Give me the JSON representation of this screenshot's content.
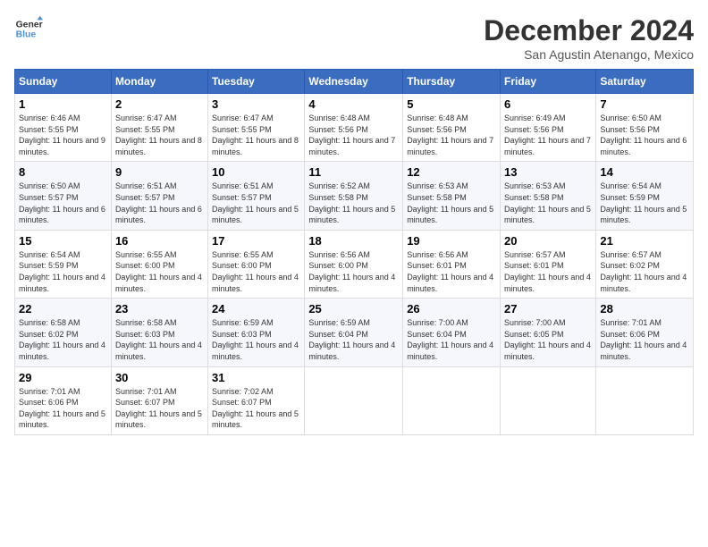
{
  "logo": {
    "line1": "General",
    "line2": "Blue"
  },
  "title": "December 2024",
  "location": "San Agustin Atenango, Mexico",
  "days_of_week": [
    "Sunday",
    "Monday",
    "Tuesday",
    "Wednesday",
    "Thursday",
    "Friday",
    "Saturday"
  ],
  "weeks": [
    [
      {
        "day": "1",
        "sunrise": "6:46 AM",
        "sunset": "5:55 PM",
        "daylight": "11 hours and 9 minutes."
      },
      {
        "day": "2",
        "sunrise": "6:47 AM",
        "sunset": "5:55 PM",
        "daylight": "11 hours and 8 minutes."
      },
      {
        "day": "3",
        "sunrise": "6:47 AM",
        "sunset": "5:55 PM",
        "daylight": "11 hours and 8 minutes."
      },
      {
        "day": "4",
        "sunrise": "6:48 AM",
        "sunset": "5:56 PM",
        "daylight": "11 hours and 7 minutes."
      },
      {
        "day": "5",
        "sunrise": "6:48 AM",
        "sunset": "5:56 PM",
        "daylight": "11 hours and 7 minutes."
      },
      {
        "day": "6",
        "sunrise": "6:49 AM",
        "sunset": "5:56 PM",
        "daylight": "11 hours and 7 minutes."
      },
      {
        "day": "7",
        "sunrise": "6:50 AM",
        "sunset": "5:56 PM",
        "daylight": "11 hours and 6 minutes."
      }
    ],
    [
      {
        "day": "8",
        "sunrise": "6:50 AM",
        "sunset": "5:57 PM",
        "daylight": "11 hours and 6 minutes."
      },
      {
        "day": "9",
        "sunrise": "6:51 AM",
        "sunset": "5:57 PM",
        "daylight": "11 hours and 6 minutes."
      },
      {
        "day": "10",
        "sunrise": "6:51 AM",
        "sunset": "5:57 PM",
        "daylight": "11 hours and 5 minutes."
      },
      {
        "day": "11",
        "sunrise": "6:52 AM",
        "sunset": "5:58 PM",
        "daylight": "11 hours and 5 minutes."
      },
      {
        "day": "12",
        "sunrise": "6:53 AM",
        "sunset": "5:58 PM",
        "daylight": "11 hours and 5 minutes."
      },
      {
        "day": "13",
        "sunrise": "6:53 AM",
        "sunset": "5:58 PM",
        "daylight": "11 hours and 5 minutes."
      },
      {
        "day": "14",
        "sunrise": "6:54 AM",
        "sunset": "5:59 PM",
        "daylight": "11 hours and 5 minutes."
      }
    ],
    [
      {
        "day": "15",
        "sunrise": "6:54 AM",
        "sunset": "5:59 PM",
        "daylight": "11 hours and 4 minutes."
      },
      {
        "day": "16",
        "sunrise": "6:55 AM",
        "sunset": "6:00 PM",
        "daylight": "11 hours and 4 minutes."
      },
      {
        "day": "17",
        "sunrise": "6:55 AM",
        "sunset": "6:00 PM",
        "daylight": "11 hours and 4 minutes."
      },
      {
        "day": "18",
        "sunrise": "6:56 AM",
        "sunset": "6:00 PM",
        "daylight": "11 hours and 4 minutes."
      },
      {
        "day": "19",
        "sunrise": "6:56 AM",
        "sunset": "6:01 PM",
        "daylight": "11 hours and 4 minutes."
      },
      {
        "day": "20",
        "sunrise": "6:57 AM",
        "sunset": "6:01 PM",
        "daylight": "11 hours and 4 minutes."
      },
      {
        "day": "21",
        "sunrise": "6:57 AM",
        "sunset": "6:02 PM",
        "daylight": "11 hours and 4 minutes."
      }
    ],
    [
      {
        "day": "22",
        "sunrise": "6:58 AM",
        "sunset": "6:02 PM",
        "daylight": "11 hours and 4 minutes."
      },
      {
        "day": "23",
        "sunrise": "6:58 AM",
        "sunset": "6:03 PM",
        "daylight": "11 hours and 4 minutes."
      },
      {
        "day": "24",
        "sunrise": "6:59 AM",
        "sunset": "6:03 PM",
        "daylight": "11 hours and 4 minutes."
      },
      {
        "day": "25",
        "sunrise": "6:59 AM",
        "sunset": "6:04 PM",
        "daylight": "11 hours and 4 minutes."
      },
      {
        "day": "26",
        "sunrise": "7:00 AM",
        "sunset": "6:04 PM",
        "daylight": "11 hours and 4 minutes."
      },
      {
        "day": "27",
        "sunrise": "7:00 AM",
        "sunset": "6:05 PM",
        "daylight": "11 hours and 4 minutes."
      },
      {
        "day": "28",
        "sunrise": "7:01 AM",
        "sunset": "6:06 PM",
        "daylight": "11 hours and 4 minutes."
      }
    ],
    [
      {
        "day": "29",
        "sunrise": "7:01 AM",
        "sunset": "6:06 PM",
        "daylight": "11 hours and 5 minutes."
      },
      {
        "day": "30",
        "sunrise": "7:01 AM",
        "sunset": "6:07 PM",
        "daylight": "11 hours and 5 minutes."
      },
      {
        "day": "31",
        "sunrise": "7:02 AM",
        "sunset": "6:07 PM",
        "daylight": "11 hours and 5 minutes."
      },
      null,
      null,
      null,
      null
    ]
  ],
  "labels": {
    "sunrise": "Sunrise:",
    "sunset": "Sunset:",
    "daylight": "Daylight:"
  }
}
